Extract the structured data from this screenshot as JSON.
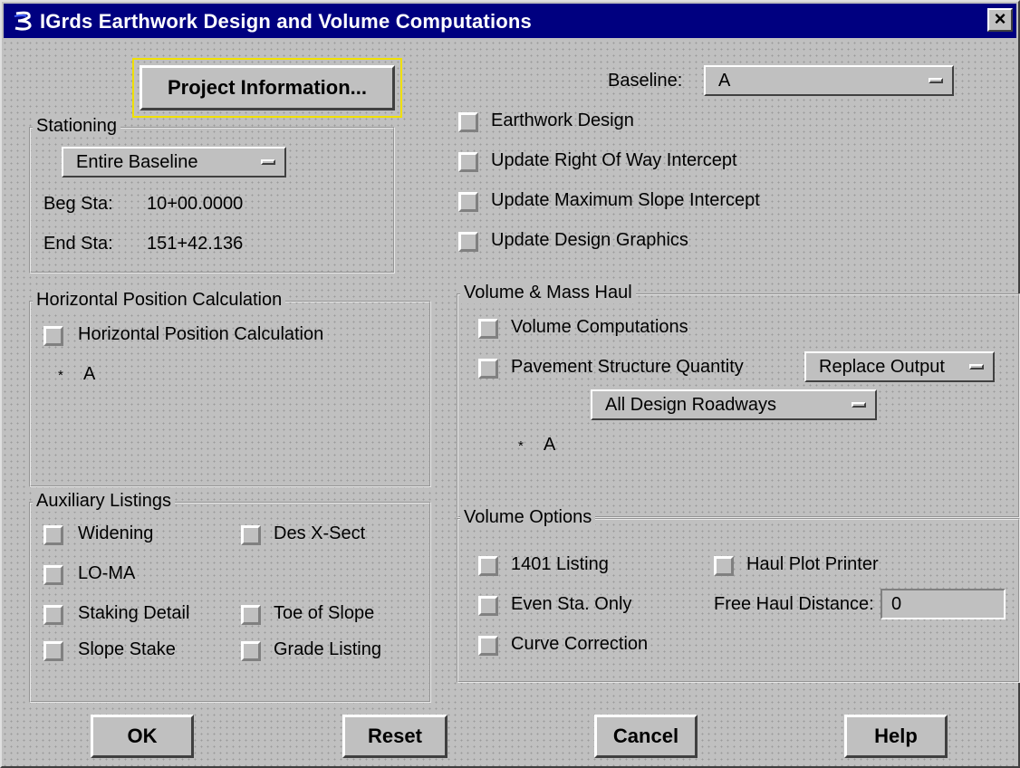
{
  "window": {
    "title": "IGrds Earthwork Design and Volume Computations",
    "close_label": "×"
  },
  "project_button": "Project Information...",
  "baseline": {
    "label": "Baseline:",
    "value": "A"
  },
  "stationing": {
    "legend": "Stationing",
    "range": "Entire Baseline",
    "beg_label": "Beg Sta:",
    "beg_value": "10+00.0000",
    "end_label": "End Sta:",
    "end_value": "151+42.136"
  },
  "design_options": [
    "Earthwork Design",
    "Update Right Of Way Intercept",
    "Update Maximum Slope Intercept",
    "Update Design Graphics"
  ],
  "horizontal": {
    "legend": "Horizontal Position Calculation",
    "checkbox": "Horizontal Position Calculation",
    "list_marker": "*",
    "list_item": "A"
  },
  "volume_mass": {
    "legend": "Volume & Mass Haul",
    "volume_computations": "Volume Computations",
    "pavement": "Pavement Structure Quantity",
    "output_mode": "Replace Output",
    "roadways": "All Design Roadways",
    "list_marker": "*",
    "list_item": "A"
  },
  "auxiliary": {
    "legend": "Auxiliary Listings",
    "widening": "Widening",
    "des_xsect": "Des X-Sect",
    "loma": "LO-MA",
    "staking": "Staking Detail",
    "toe": "Toe of Slope",
    "slope_stake": "Slope Stake",
    "grade": "Grade Listing"
  },
  "volume_options": {
    "legend": "Volume Options",
    "listing": "1401 Listing",
    "haul_plot": "Haul Plot Printer",
    "even_sta": "Even Sta. Only",
    "free_haul_label": "Free Haul Distance:",
    "free_haul_value": "0",
    "curve": "Curve Correction"
  },
  "buttons": {
    "ok": "OK",
    "reset": "Reset",
    "cancel": "Cancel",
    "help": "Help"
  },
  "colors": {
    "titlebar": "#000080",
    "face": "#c0c0c0",
    "focus": "#f0e000"
  }
}
